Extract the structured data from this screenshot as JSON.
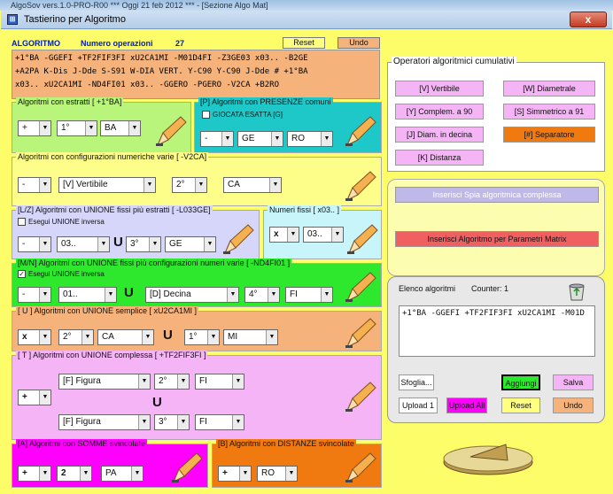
{
  "outer_title": "AlgoSov vers.1.0-PRO-R00  ***  Oggi 21 feb 2012  ***  - [Sezione Algo Mat]",
  "window": {
    "title": "Tastierino per Algoritmo",
    "close": "x"
  },
  "header": {
    "algoritmo_label": "ALGORITMO",
    "numero_label": "Numero operazioni",
    "numero_value": "27",
    "reset": "Reset",
    "undo": "Undo"
  },
  "code_lines": [
    "+1°BA -GGEFI +TF2FIF3FI xU2CA1MI -M01D4FI -Z3GE03 x03.. -B2GE",
    "+A2PA K-Dis J-Dde S-S91 W-DIA VERT. Y-C90 Y-C90 J-Dde # +1°BA",
    "x03.. xU2CA1MI -ND4FI01 x03.. -GGERO -PGERO -V2CA +B2RO"
  ],
  "estratti": {
    "legend": "Algoritmi con estratti  [ +1°BA]",
    "op": "+",
    "pos": "1°",
    "ruota": "BA"
  },
  "presenze": {
    "legend": "[P] Algoritmi con PRESENZE comuni",
    "check": "GIOCATA ESATTA  [G]",
    "op": "-",
    "r1": "GE",
    "r2": "RO"
  },
  "config": {
    "legend": "Algoritmi con configurazioni numeriche varie  [ -V2CA]",
    "op": "-",
    "tipo": "[V] Vertibile",
    "pos": "2°",
    "ruota": "CA"
  },
  "unione_fissi": {
    "legend": "[L/Z] Algoritmi con UNIONE fissi più estratti  [ -L033GE]",
    "check": "Esegui UNIONE inversa",
    "op": "-",
    "num": "03..",
    "u": "U",
    "pos": "3°",
    "ruota": "GE"
  },
  "fissi": {
    "legend": "Numeri fissi  [ x03.. ]",
    "op": "x",
    "num": "03.."
  },
  "unione_config": {
    "legend": "[M/N] Algoritmi con UNIONE fissi più configurazioni numeri varie  [ -ND4FI01 ]",
    "check": "Esegui UNIONE inversa",
    "op": "-",
    "num": "01..",
    "u": "U",
    "tipo": "[D] Decina",
    "pos": "4°",
    "ruota": "FI"
  },
  "unione_semplice": {
    "legend": "[ U ] Algoritmi con UNIONE semplice  [ xU2CA1MI ]",
    "op": "x",
    "p1": "2°",
    "r1": "CA",
    "u": "U",
    "p2": "1°",
    "r2": "MI"
  },
  "unione_complessa": {
    "legend": "[ T ] Algoritmi con UNIONE complessa  [ +TF2FIF3FI ]",
    "op": "+",
    "t1": "[F] Figura",
    "p1": "2°",
    "r1": "FI",
    "u": "U",
    "t2": "[F] Figura",
    "p2": "3°",
    "r2": "FI"
  },
  "somme": {
    "legend": "[A] Algoritmi con SOMME svincolate",
    "op": "+",
    "num": "2",
    "ruota": "PA"
  },
  "distanze": {
    "legend": "[B] Algoritmi con DISTANZE svincolate",
    "op": "+",
    "ruota": "RO"
  },
  "operatori": {
    "legend": "Operatori algoritmici cumulativi",
    "buttons": [
      "[V] Vertibile",
      "[W] Diametrale",
      "[Y] Complem. a 90",
      "[S] Simmetrico  a 91",
      "[J] Diam. in decina",
      "[#] Separatore",
      "[K] Distanza"
    ]
  },
  "spia": {
    "btn1": "Inserisci Spia algoritmica complessa",
    "btn2": "Inserisci Algoritmo per Parametri Matrix"
  },
  "elenco": {
    "title": "Elenco algoritmi",
    "counter": "Counter: 1",
    "text": "+1°BA -GGEFI +TF2FIF3FI xU2CA1MI -M01D",
    "sfoglia": "Sfoglia...",
    "aggiungi": "Aggiungi",
    "salva": "Salva",
    "upload1": "Upload 1",
    "uploadall": "Upload All",
    "reset": "Reset",
    "undo": "Undo"
  },
  "colors": {
    "yellow": "#fdfd6a",
    "green": "#b8f57a",
    "teal": "#1ec8c8",
    "lilac": "#d6d6fa",
    "lightcyan": "#c8f5fa",
    "lime": "#2ee82e",
    "orange": "#f5b27a",
    "pink": "#f5b4f5",
    "magenta": "#ff00ff",
    "orangebtn": "#f07a10"
  }
}
